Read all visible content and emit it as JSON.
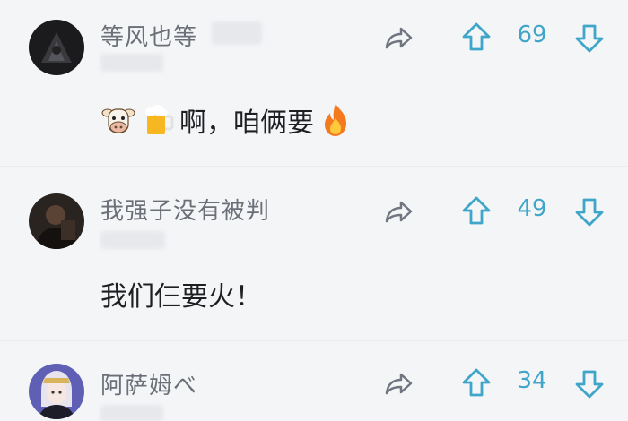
{
  "comments": [
    {
      "username": "等风也等",
      "likes": "69",
      "text_main": "啊，咱俩要",
      "emoji_before": [
        "cow-face-icon",
        "beer-mug-icon"
      ],
      "emoji_after": "fire-icon"
    },
    {
      "username": "我强子没有被判",
      "likes": "49",
      "text_main": "我们仨要火！"
    },
    {
      "username": "阿萨姆べ",
      "likes": "34"
    }
  ],
  "colors": {
    "accent": "#3fa6c9",
    "username": "#6b6f78",
    "text": "#1e1f22",
    "background": "#f4f5f7"
  }
}
